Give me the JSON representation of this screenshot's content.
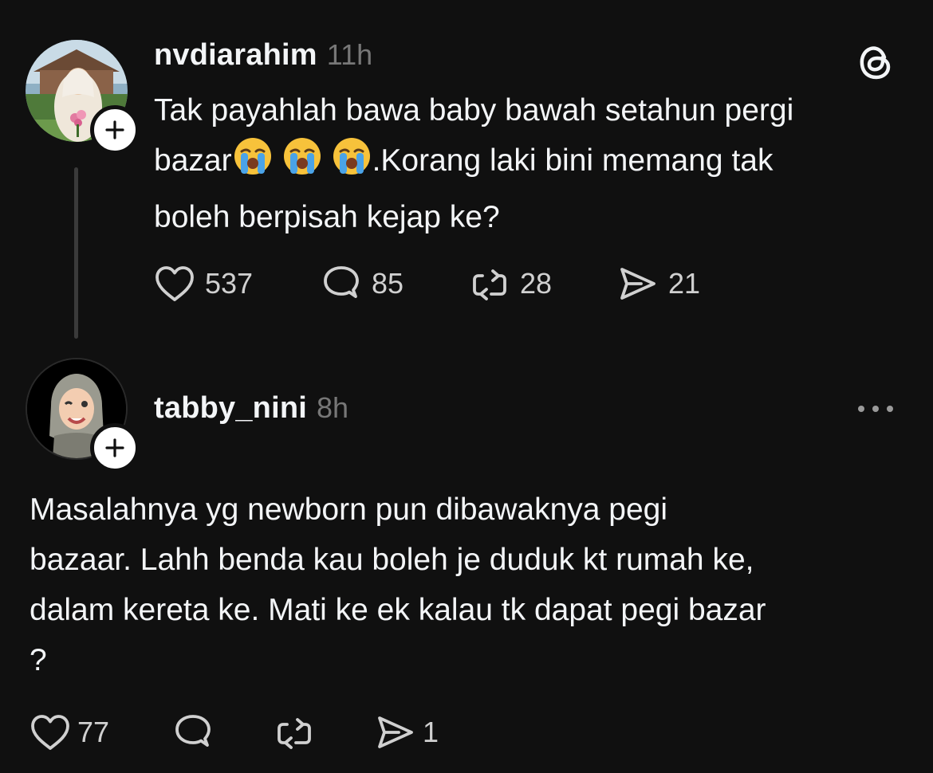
{
  "post": {
    "username": "nvdiarahim",
    "time": "11h",
    "text_line1": "Tak payahlah bawa baby bawah setahun pergi",
    "text_line2_pre": "bazar",
    "text_line2_post": ".Korang laki bini memang tak",
    "text_line3": "boleh berpisah kejap ke?",
    "emoji": [
      "loudly-crying-face",
      "loudly-crying-face",
      "loudly-crying-face"
    ],
    "likes": "537",
    "replies": "85",
    "reposts": "28",
    "shares": "21"
  },
  "reply": {
    "username": "tabby_nini",
    "time": "8h",
    "text_line1": "Masalahnya yg newborn pun dibawaknya pegi",
    "text_line2": "bazaar. Lahh benda kau boleh je duduk kt rumah ke,",
    "text_line3": "dalam kereta ke. Mati ke ek kalau tk dapat pegi bazar",
    "text_line4": "?",
    "likes": "77",
    "shares": "1"
  },
  "icons": {
    "app_logo": "threads-logo-icon",
    "more": "more-options-icon",
    "like": "heart-icon",
    "reply": "comment-bubble-icon",
    "repost": "repost-icon",
    "share": "send-icon",
    "follow": "plus-icon"
  },
  "colors": {
    "background": "#101010",
    "text": "#f3f5f7",
    "secondary": "#777777"
  }
}
